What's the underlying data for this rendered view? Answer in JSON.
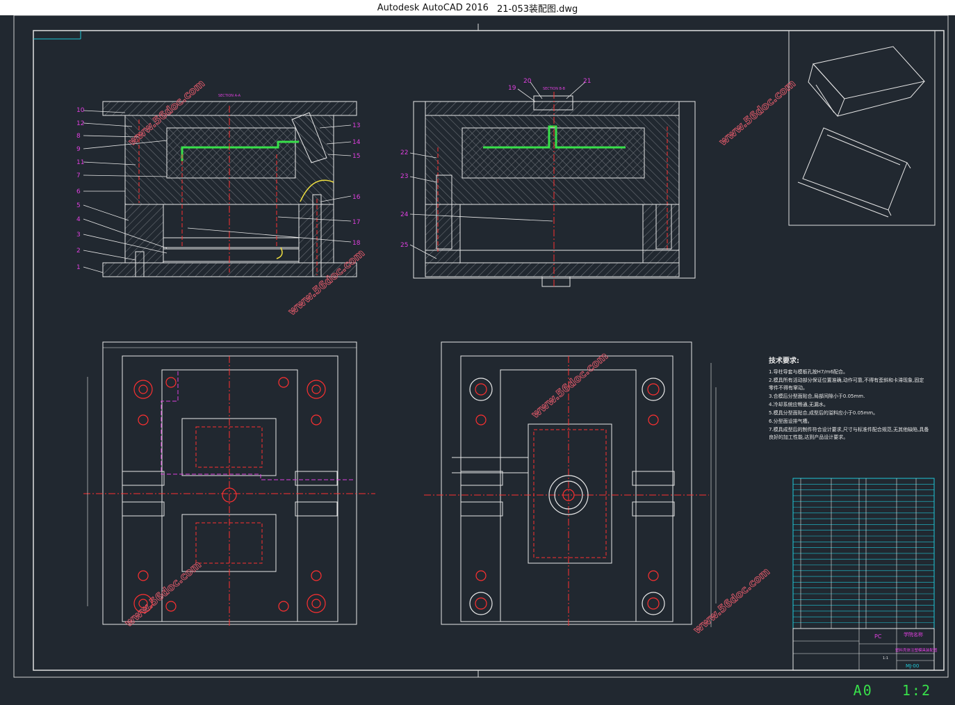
{
  "window": {
    "app_title": "Autodesk AutoCAD 2016",
    "file_name": "21-053装配图.dwg"
  },
  "drawing": {
    "paper_size": "A0",
    "scale": "1:2",
    "section_label_1": "SECTION A-A",
    "section_label_2": "SECTION B-B",
    "left_part_numbers": [
      "10",
      "12",
      "8",
      "9",
      "11",
      "7",
      "6",
      "5",
      "4",
      "3",
      "2",
      "1"
    ],
    "right_part_numbers": [
      "13",
      "14",
      "15",
      "16",
      "17",
      "18"
    ],
    "side_part_numbers": [
      "22",
      "23",
      "24",
      "25"
    ],
    "top_part_numbers": [
      "19",
      "20",
      "21"
    ],
    "watermark": "www.56doc.com",
    "colors": {
      "background": "#212830",
      "lines": "#e8e8e8",
      "magenta": "#e040e0",
      "red": "#ff3030",
      "green": "#38e04a",
      "cyan": "#20c8d8",
      "yellow": "#f0e040"
    }
  },
  "tech": {
    "title": "技术要求:",
    "items": [
      "1.导柱导套与模板孔按H7/m6配合。",
      "2.模具所有活动部分保证位置准确,动作可靠,不得有歪斜和卡滞现象,固定",
      "零件不得有窜动。",
      "3.合模后分型面贴合,局部间隙小于0.05mm.",
      "4.冷却系统应畅通,无漏水。",
      "5.模具分型面贴合,成型后的溢料应小于0.05mm。",
      "6.分型面设排气槽。",
      "7.模具成型后的制件符合设计要求,尺寸与标准件配合规范,无其他缺陷,具备",
      "良好的加工性能,达到产品设计要求。"
    ]
  },
  "titleblock": {
    "material": "PC",
    "school": "学院名称",
    "drawing_name": "塑料壳体注塑模具装配图",
    "drawing_no": "MJ-00",
    "scale_cell": "1:1"
  }
}
